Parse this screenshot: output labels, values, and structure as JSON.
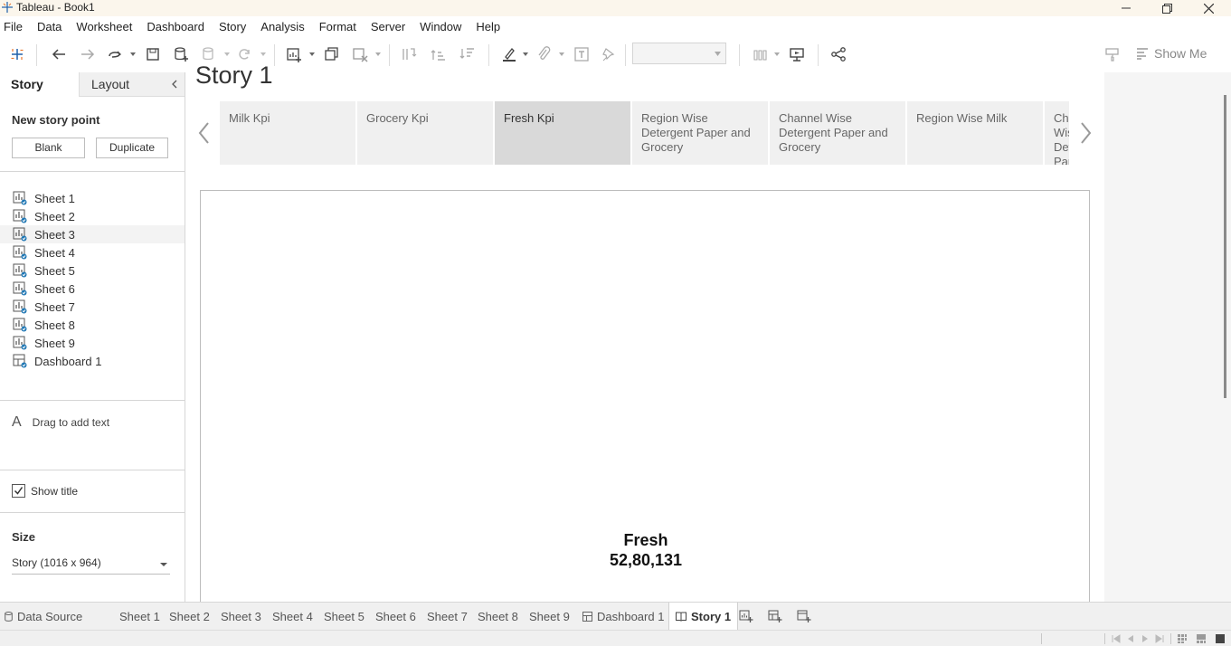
{
  "window": {
    "title": "Tableau - Book1"
  },
  "menu": [
    "File",
    "Data",
    "Worksheet",
    "Dashboard",
    "Story",
    "Analysis",
    "Format",
    "Server",
    "Window",
    "Help"
  ],
  "toolbar": {
    "show_me": "Show Me"
  },
  "left_pane": {
    "tab_story": "Story",
    "tab_layout": "Layout",
    "new_story_point": "New story point",
    "blank": "Blank",
    "duplicate": "Duplicate",
    "sheets": [
      "Sheet 1",
      "Sheet 2",
      "Sheet 3",
      "Sheet 4",
      "Sheet 5",
      "Sheet 6",
      "Sheet 7",
      "Sheet 8",
      "Sheet 9",
      "Dashboard 1"
    ],
    "drag_text": "Drag to add text",
    "show_title": "Show title",
    "size_title": "Size",
    "size_value": "Story (1016 x 964)"
  },
  "story": {
    "title": "Story 1",
    "points": [
      {
        "label": "Milk Kpi",
        "active": false
      },
      {
        "label": "Grocery Kpi",
        "active": false
      },
      {
        "label": "Fresh Kpi",
        "active": true
      },
      {
        "label": "Region Wise Detergent Paper and Grocery",
        "active": false
      },
      {
        "label": "Channel Wise Detergent Paper and Grocery",
        "active": false
      },
      {
        "label": "Region Wise Milk",
        "active": false
      },
      {
        "label": "Channel Wise Detergent Paper and Frozen",
        "active": false
      }
    ],
    "kpi_label": "Fresh",
    "kpi_value": "52,80,131"
  },
  "bottom_tabs": {
    "data_source": "Data Source",
    "sheets": [
      "Sheet 1",
      "Sheet 2",
      "Sheet 3",
      "Sheet 4",
      "Sheet 5",
      "Sheet 6",
      "Sheet 7",
      "Sheet 8",
      "Sheet 9"
    ],
    "dashboard": "Dashboard 1",
    "story": "Story 1"
  },
  "colors": {
    "accent_blue": "#1f77b4",
    "active_point": "#d9d9d9",
    "story_point_bg": "#f0f0f0"
  }
}
